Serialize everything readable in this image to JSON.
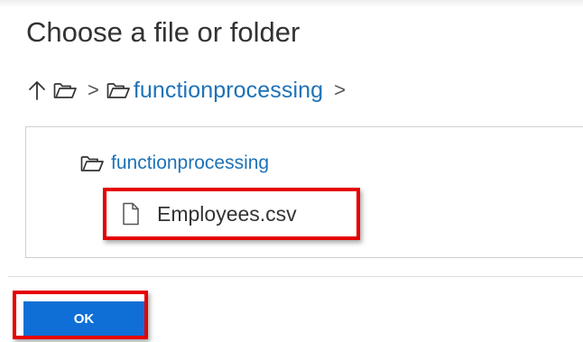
{
  "dialog": {
    "title": "Choose a file or folder"
  },
  "breadcrumb": {
    "up_icon": "up-arrow-icon",
    "root_icon": "folder-icon",
    "separator": ">",
    "folder_icon": "folder-icon",
    "current_folder": "functionprocessing",
    "trailing_separator": ">"
  },
  "tree": {
    "folder": {
      "icon": "folder-icon",
      "label": "functionprocessing"
    },
    "files": [
      {
        "icon": "file-icon",
        "label": "Employees.csv",
        "highlighted": true
      }
    ]
  },
  "footer": {
    "ok_label": "OK",
    "ok_highlighted": true
  },
  "colors": {
    "link": "#1d72b8",
    "primary_button": "#0f6fd6",
    "highlight_border": "#e60000"
  }
}
